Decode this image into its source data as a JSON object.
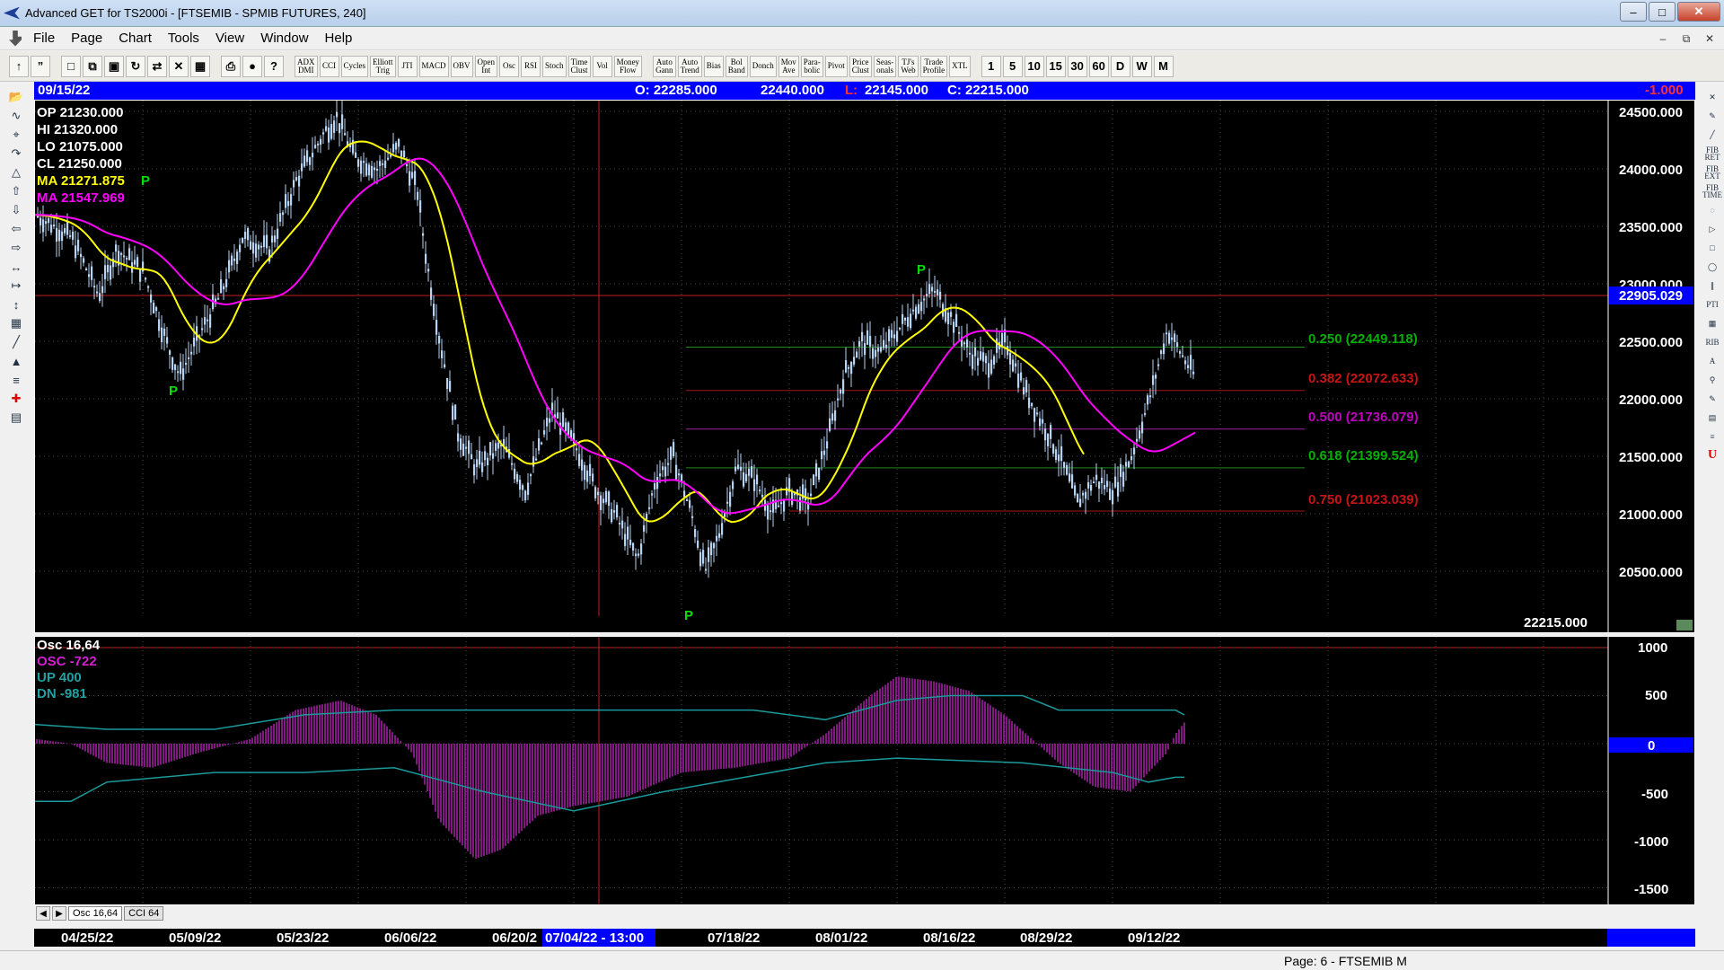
{
  "window": {
    "title": "Advanced GET for TS2000i - [FTSEMIB - SPMIB FUTURES, 240]"
  },
  "menu": [
    "File",
    "Page",
    "Chart",
    "Tools",
    "View",
    "Window",
    "Help"
  ],
  "toolbar": {
    "studies": [
      "ADX\nDMI",
      "CCI",
      "Cycles",
      "Elliott\nTrig",
      "JTI",
      "MACD",
      "OBV",
      "Open\nInt",
      "Osc",
      "RSI",
      "Stoch",
      "Time\nClust",
      "Vol",
      "Money\nFlow"
    ],
    "overlays": [
      "Auto\nGann",
      "Auto\nTrend",
      "Bias",
      "Bol\nBand",
      "Donch",
      "Mov\nAve",
      "Para-\nbolic",
      "Pivot",
      "Price\nClust",
      "Seas-\nonals",
      "TJ's\nWeb",
      "Trade\nProfile",
      "XTL"
    ],
    "intervals": [
      "1",
      "5",
      "10",
      "15",
      "30",
      "60",
      "D",
      "W",
      "M"
    ]
  },
  "header": {
    "date": "09/15/22",
    "open": "O: 22285.000",
    "high": "22440.000",
    "low_label": "L:",
    "low": "22145.000",
    "close": "C: 22215.000",
    "change": "-1.000"
  },
  "legend": {
    "op": "OP 21230.000",
    "hi": "HI  21320.000",
    "lo": "LO  21075.000",
    "cl": "CL  21250.000",
    "ma1": "MA  21271.875",
    "ma1_flag": "P",
    "ma2": "MA  21547.969"
  },
  "price_axis": [
    "24500.000",
    "24000.000",
    "23500.000",
    "23000.000",
    "22500.000",
    "22000.000",
    "21500.000",
    "21000.000",
    "20500.000"
  ],
  "cursor_price": "22905.029",
  "last_price": "22215.000",
  "pivots": [
    "P",
    "P",
    "P"
  ],
  "fib_levels": [
    {
      "label": "0.250 (22449.118)",
      "color": "#00c800"
    },
    {
      "label": "0.382 (22072.633)",
      "color": "#d01818"
    },
    {
      "label": "0.500 (21736.079)",
      "color": "#c800c8"
    },
    {
      "label": "0.618 (21399.524)",
      "color": "#00c800"
    },
    {
      "label": "0.750 (21023.039)",
      "color": "#d01818"
    }
  ],
  "osc_legend": {
    "osc": "Osc 16,64",
    "osc_val": "OSC -722",
    "up": "UP   400",
    "dn": "DN   -981"
  },
  "osc_axis": [
    "1000",
    "500",
    "0",
    "-500",
    "-1000",
    "-1500"
  ],
  "tabs": [
    "Osc 16,64",
    "CCI 64"
  ],
  "dates": [
    "04/25/22",
    "05/09/22",
    "05/23/22",
    "06/06/22",
    "06/20/2",
    "08/01/22",
    "07/18/22",
    "08/16/22",
    "08/29/22",
    "09/12/22"
  ],
  "cursor_date": "07/04/22 - 13:00",
  "status": "Page: 6 - FTSEMIB M",
  "colors": {
    "price": "#b8d2f2",
    "ma_fast": "#ffff00",
    "ma_slow": "#ff00ff",
    "osc_bars": "#a020a0",
    "bands": "#1a9a9a",
    "header": "#0000ff"
  }
}
